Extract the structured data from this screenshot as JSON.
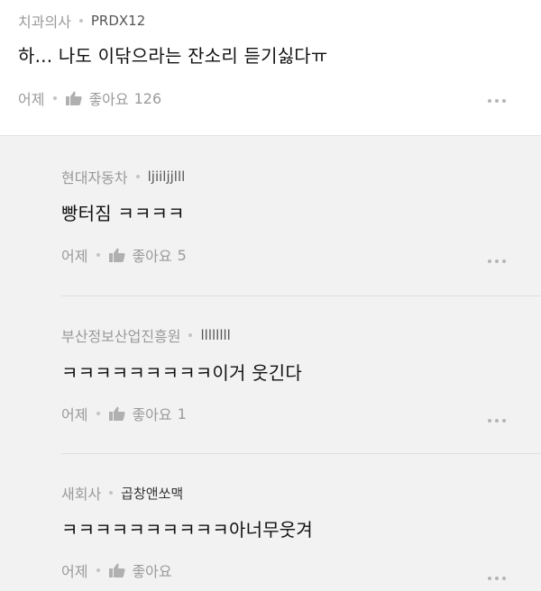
{
  "main_comment": {
    "author": "치과의사",
    "nickname": "PRDX12",
    "text": "하... 나도 이닦으라는 잔소리 듣기싫다ㅠ",
    "time": "어제",
    "like_label": "좋아요",
    "like_count": "126"
  },
  "replies": [
    {
      "author": "현대자동차",
      "nickname": "ljiiljjlll",
      "text": "빵터짐 ㅋㅋㅋㅋ",
      "time": "어제",
      "like_label": "좋아요",
      "like_count": "5"
    },
    {
      "author": "부산정보산업진흥원",
      "nickname": "llllllll",
      "text": "ㅋㅋㅋㅋㅋㅋㅋㅋㅋ이거 웃긴다",
      "time": "어제",
      "like_label": "좋아요",
      "like_count": "1"
    },
    {
      "author": "새회사",
      "nickname": "곱창앤쏘맥",
      "text": "ㅋㅋㅋㅋㅋㅋㅋㅋㅋㅋ아너무웃겨",
      "time": "어제",
      "like_label": "좋아요",
      "like_count": ""
    }
  ],
  "icons": {
    "like": "thumbs-up-icon",
    "more": "more-options-icon"
  },
  "colors": {
    "reply_background": "#f2f2f2",
    "meta_text": "#9a9a9a",
    "body_text": "#111111"
  }
}
